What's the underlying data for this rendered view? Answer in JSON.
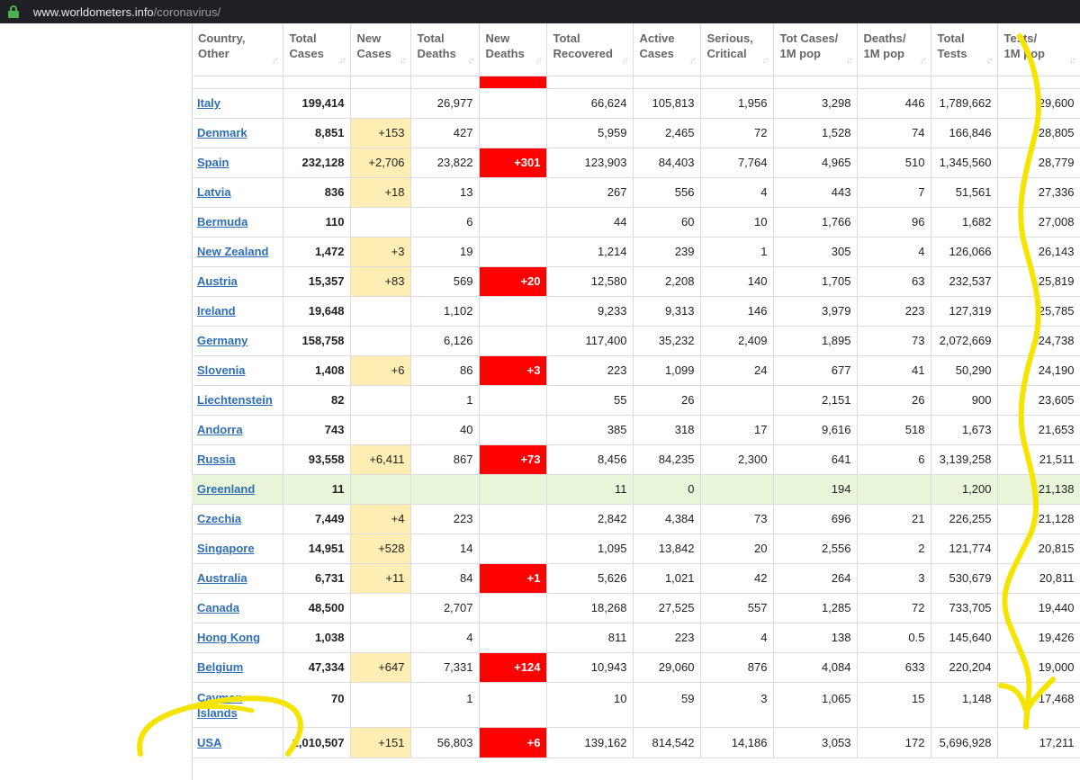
{
  "browser": {
    "url_host": "www.worldometers.info",
    "url_path": "/coronavirus/"
  },
  "table": {
    "headers": [
      {
        "line1": "Country,",
        "line2": "Other"
      },
      {
        "line1": "Total",
        "line2": "Cases"
      },
      {
        "line1": "New",
        "line2": "Cases"
      },
      {
        "line1": "Total",
        "line2": "Deaths"
      },
      {
        "line1": "New",
        "line2": "Deaths"
      },
      {
        "line1": "Total",
        "line2": "Recovered"
      },
      {
        "line1": "Active",
        "line2": "Cases"
      },
      {
        "line1": "Serious,",
        "line2": "Critical"
      },
      {
        "line1": "Tot Cases/",
        "line2": "1M pop"
      },
      {
        "line1": "Deaths/",
        "line2": "1M pop"
      },
      {
        "line1": "Total",
        "line2": "Tests"
      },
      {
        "line1": "Tests/",
        "line2": "1M pop"
      }
    ],
    "rows": [
      {
        "country": "Italy",
        "total_cases": "199,414",
        "new_cases": "",
        "total_deaths": "26,977",
        "new_deaths": "",
        "total_recovered": "66,624",
        "active_cases": "105,813",
        "serious": "1,956",
        "cases_per_1m": "3,298",
        "deaths_per_1m": "446",
        "total_tests": "1,789,662",
        "tests_per_1m": "29,600"
      },
      {
        "country": "Denmark",
        "total_cases": "8,851",
        "new_cases": "+153",
        "total_deaths": "427",
        "new_deaths": "",
        "total_recovered": "5,959",
        "active_cases": "2,465",
        "serious": "72",
        "cases_per_1m": "1,528",
        "deaths_per_1m": "74",
        "total_tests": "166,846",
        "tests_per_1m": "28,805"
      },
      {
        "country": "Spain",
        "total_cases": "232,128",
        "new_cases": "+2,706",
        "total_deaths": "23,822",
        "new_deaths": "+301",
        "total_recovered": "123,903",
        "active_cases": "84,403",
        "serious": "7,764",
        "cases_per_1m": "4,965",
        "deaths_per_1m": "510",
        "total_tests": "1,345,560",
        "tests_per_1m": "28,779"
      },
      {
        "country": "Latvia",
        "total_cases": "836",
        "new_cases": "+18",
        "total_deaths": "13",
        "new_deaths": "",
        "total_recovered": "267",
        "active_cases": "556",
        "serious": "4",
        "cases_per_1m": "443",
        "deaths_per_1m": "7",
        "total_tests": "51,561",
        "tests_per_1m": "27,336"
      },
      {
        "country": "Bermuda",
        "total_cases": "110",
        "new_cases": "",
        "total_deaths": "6",
        "new_deaths": "",
        "total_recovered": "44",
        "active_cases": "60",
        "serious": "10",
        "cases_per_1m": "1,766",
        "deaths_per_1m": "96",
        "total_tests": "1,682",
        "tests_per_1m": "27,008"
      },
      {
        "country": "New Zealand",
        "total_cases": "1,472",
        "new_cases": "+3",
        "total_deaths": "19",
        "new_deaths": "",
        "total_recovered": "1,214",
        "active_cases": "239",
        "serious": "1",
        "cases_per_1m": "305",
        "deaths_per_1m": "4",
        "total_tests": "126,066",
        "tests_per_1m": "26,143"
      },
      {
        "country": "Austria",
        "total_cases": "15,357",
        "new_cases": "+83",
        "total_deaths": "569",
        "new_deaths": "+20",
        "total_recovered": "12,580",
        "active_cases": "2,208",
        "serious": "140",
        "cases_per_1m": "1,705",
        "deaths_per_1m": "63",
        "total_tests": "232,537",
        "tests_per_1m": "25,819"
      },
      {
        "country": "Ireland",
        "total_cases": "19,648",
        "new_cases": "",
        "total_deaths": "1,102",
        "new_deaths": "",
        "total_recovered": "9,233",
        "active_cases": "9,313",
        "serious": "146",
        "cases_per_1m": "3,979",
        "deaths_per_1m": "223",
        "total_tests": "127,319",
        "tests_per_1m": "25,785"
      },
      {
        "country": "Germany",
        "total_cases": "158,758",
        "new_cases": "",
        "total_deaths": "6,126",
        "new_deaths": "",
        "total_recovered": "117,400",
        "active_cases": "35,232",
        "serious": "2,409",
        "cases_per_1m": "1,895",
        "deaths_per_1m": "73",
        "total_tests": "2,072,669",
        "tests_per_1m": "24,738"
      },
      {
        "country": "Slovenia",
        "total_cases": "1,408",
        "new_cases": "+6",
        "total_deaths": "86",
        "new_deaths": "+3",
        "total_recovered": "223",
        "active_cases": "1,099",
        "serious": "24",
        "cases_per_1m": "677",
        "deaths_per_1m": "41",
        "total_tests": "50,290",
        "tests_per_1m": "24,190"
      },
      {
        "country": "Liechtenstein",
        "total_cases": "82",
        "new_cases": "",
        "total_deaths": "1",
        "new_deaths": "",
        "total_recovered": "55",
        "active_cases": "26",
        "serious": "",
        "cases_per_1m": "2,151",
        "deaths_per_1m": "26",
        "total_tests": "900",
        "tests_per_1m": "23,605"
      },
      {
        "country": "Andorra",
        "total_cases": "743",
        "new_cases": "",
        "total_deaths": "40",
        "new_deaths": "",
        "total_recovered": "385",
        "active_cases": "318",
        "serious": "17",
        "cases_per_1m": "9,616",
        "deaths_per_1m": "518",
        "total_tests": "1,673",
        "tests_per_1m": "21,653"
      },
      {
        "country": "Russia",
        "total_cases": "93,558",
        "new_cases": "+6,411",
        "total_deaths": "867",
        "new_deaths": "+73",
        "total_recovered": "8,456",
        "active_cases": "84,235",
        "serious": "2,300",
        "cases_per_1m": "641",
        "deaths_per_1m": "6",
        "total_tests": "3,139,258",
        "tests_per_1m": "21,511"
      },
      {
        "country": "Greenland",
        "total_cases": "11",
        "new_cases": "",
        "total_deaths": "",
        "new_deaths": "",
        "total_recovered": "11",
        "active_cases": "0",
        "serious": "",
        "cases_per_1m": "194",
        "deaths_per_1m": "",
        "total_tests": "1,200",
        "tests_per_1m": "21,138",
        "green": true
      },
      {
        "country": "Czechia",
        "total_cases": "7,449",
        "new_cases": "+4",
        "total_deaths": "223",
        "new_deaths": "",
        "total_recovered": "2,842",
        "active_cases": "4,384",
        "serious": "73",
        "cases_per_1m": "696",
        "deaths_per_1m": "21",
        "total_tests": "226,255",
        "tests_per_1m": "21,128"
      },
      {
        "country": "Singapore",
        "total_cases": "14,951",
        "new_cases": "+528",
        "total_deaths": "14",
        "new_deaths": "",
        "total_recovered": "1,095",
        "active_cases": "13,842",
        "serious": "20",
        "cases_per_1m": "2,556",
        "deaths_per_1m": "2",
        "total_tests": "121,774",
        "tests_per_1m": "20,815"
      },
      {
        "country": "Australia",
        "total_cases": "6,731",
        "new_cases": "+11",
        "total_deaths": "84",
        "new_deaths": "+1",
        "total_recovered": "5,626",
        "active_cases": "1,021",
        "serious": "42",
        "cases_per_1m": "264",
        "deaths_per_1m": "3",
        "total_tests": "530,679",
        "tests_per_1m": "20,811"
      },
      {
        "country": "Canada",
        "total_cases": "48,500",
        "new_cases": "",
        "total_deaths": "2,707",
        "new_deaths": "",
        "total_recovered": "18,268",
        "active_cases": "27,525",
        "serious": "557",
        "cases_per_1m": "1,285",
        "deaths_per_1m": "72",
        "total_tests": "733,705",
        "tests_per_1m": "19,440"
      },
      {
        "country": "Hong Kong",
        "total_cases": "1,038",
        "new_cases": "",
        "total_deaths": "4",
        "new_deaths": "",
        "total_recovered": "811",
        "active_cases": "223",
        "serious": "4",
        "cases_per_1m": "138",
        "deaths_per_1m": "0.5",
        "total_tests": "145,640",
        "tests_per_1m": "19,426"
      },
      {
        "country": "Belgium",
        "total_cases": "47,334",
        "new_cases": "+647",
        "total_deaths": "7,331",
        "new_deaths": "+124",
        "total_recovered": "10,943",
        "active_cases": "29,060",
        "serious": "876",
        "cases_per_1m": "4,084",
        "deaths_per_1m": "633",
        "total_tests": "220,204",
        "tests_per_1m": "19,000"
      },
      {
        "country": "Cayman Islands",
        "total_cases": "70",
        "new_cases": "",
        "total_deaths": "1",
        "new_deaths": "",
        "total_recovered": "10",
        "active_cases": "59",
        "serious": "3",
        "cases_per_1m": "1,065",
        "deaths_per_1m": "15",
        "total_tests": "1,148",
        "tests_per_1m": "17,468",
        "tall": true
      },
      {
        "country": "USA",
        "total_cases": "1,010,507",
        "new_cases": "+151",
        "total_deaths": "56,803",
        "new_deaths": "+6",
        "total_recovered": "139,162",
        "active_cases": "814,542",
        "serious": "14,186",
        "cases_per_1m": "3,053",
        "deaths_per_1m": "172",
        "total_tests": "5,696,928",
        "tests_per_1m": "17,211",
        "last": true
      }
    ]
  },
  "annotation": {
    "color": "#f5e400"
  }
}
